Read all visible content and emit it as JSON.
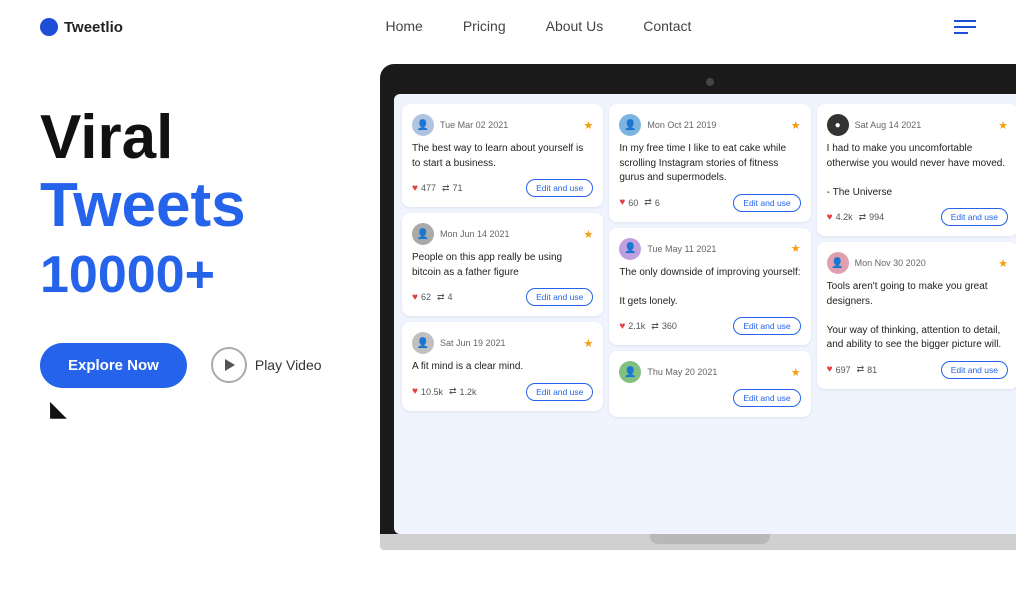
{
  "navbar": {
    "logo_text": "Tweetlio",
    "links": [
      {
        "label": "Home",
        "id": "home"
      },
      {
        "label": "Pricing",
        "id": "pricing"
      },
      {
        "label": "About Us",
        "id": "about"
      },
      {
        "label": "Contact",
        "id": "contact"
      }
    ]
  },
  "hero": {
    "title_line1": "Viral",
    "title_line2": "Tweets",
    "count": "10000+",
    "explore_btn": "Explore Now",
    "play_btn": "Play Video"
  },
  "tweets": {
    "col1": [
      {
        "date": "Tue Mar 02 2021",
        "text": "The best way to learn about yourself is to start a business.",
        "likes": "477",
        "retweets": "71",
        "edit_btn": "Edit and use"
      },
      {
        "date": "Mon Jun 14 2021",
        "text": "People on this app really be using bitcoin as a father figure",
        "likes": "62",
        "retweets": "4",
        "edit_btn": "Edit and use"
      },
      {
        "date": "Sat Jun 19 2021",
        "text": "A fit mind is a clear mind.",
        "likes": "10.5k",
        "retweets": "1.2k",
        "edit_btn": "Edit and use"
      }
    ],
    "col2": [
      {
        "date": "Mon Oct 21 2019",
        "text": "In my free time I like to eat cake while scrolling Instagram stories of fitness gurus and supermodels.",
        "likes": "60",
        "retweets": "6",
        "edit_btn": "Edit and use"
      },
      {
        "date": "Tue May 11 2021",
        "text": "The only downside of improving yourself:\n\nIt gets lonely.",
        "likes": "2.1k",
        "retweets": "360",
        "edit_btn": "Edit and use"
      },
      {
        "date": "Thu May 20 2021",
        "text": "",
        "likes": "",
        "retweets": "",
        "edit_btn": "Edit and use"
      }
    ],
    "col3": [
      {
        "date": "Sat Aug 14 2021",
        "text": "I had to make you uncomfortable otherwise you would never have moved.\n\n- The Universe",
        "likes": "4.2k",
        "retweets": "994",
        "edit_btn": "Edit and use"
      },
      {
        "date": "Mon Nov 30 2020",
        "text": "Tools aren't going to make you great designers.\n\nYour way of thinking, attention to detail, and ability to see the bigger picture will.",
        "likes": "697",
        "retweets": "81",
        "edit_btn": "Edit and use"
      }
    ]
  }
}
